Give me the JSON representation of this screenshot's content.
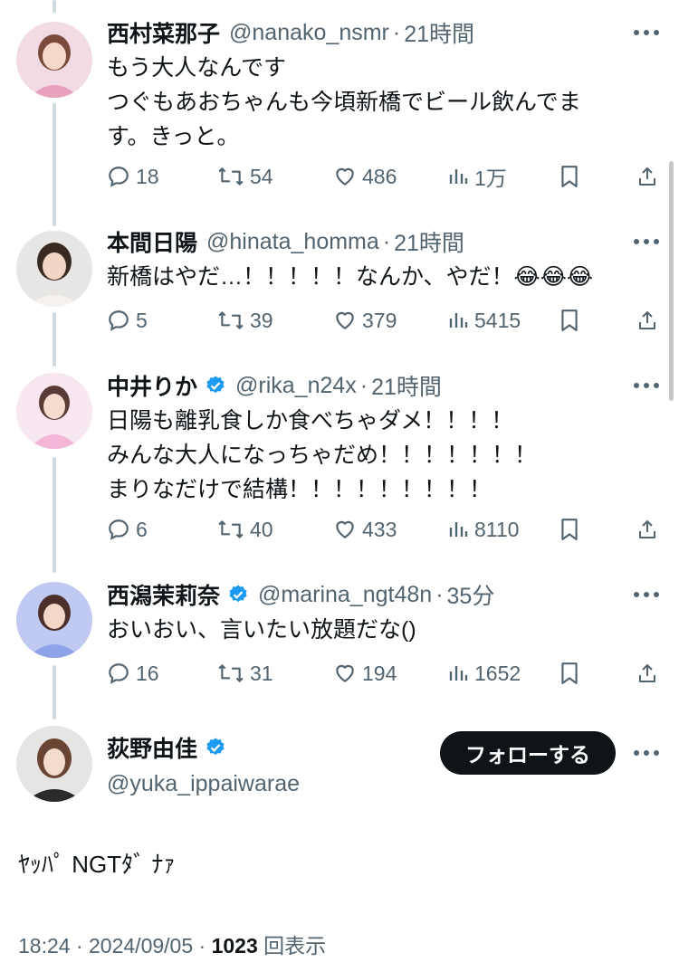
{
  "colors": {
    "text": "#0f1419",
    "secondary": "#536471",
    "verified": "#1d9bf0",
    "thread_line": "#cfd9de",
    "follow_bg": "#0f1419"
  },
  "replies": [
    {
      "name": "西村菜那子",
      "verified": false,
      "handle": "@nanako_nsmr",
      "time": "21時間",
      "text": "もう大人なんです\nつぐもあおちゃんも今頃新橋でビール飲んでま\nす。きっと。",
      "stats": {
        "replies": "18",
        "retweets": "54",
        "likes": "486",
        "views": "1万"
      }
    },
    {
      "name": "本間日陽",
      "verified": false,
      "handle": "@hinata_homma",
      "time": "21時間",
      "text": "新橋はやだ…！！！！！なんか、やだ！😂😂😂",
      "stats": {
        "replies": "5",
        "retweets": "39",
        "likes": "379",
        "views": "5415"
      }
    },
    {
      "name": "中井りか",
      "verified": true,
      "handle": "@rika_n24x",
      "time": "21時間",
      "text": "日陽も離乳食しか食べちゃダメ！！！！\nみんな大人になっちゃだめ！！！！！！！\nまりなだけで結構！！！！！！！！！",
      "stats": {
        "replies": "6",
        "retweets": "40",
        "likes": "433",
        "views": "8110"
      }
    },
    {
      "name": "西潟茉莉奈",
      "verified": true,
      "handle": "@marina_ngt48n",
      "time": "35分",
      "text": "おいおい、言いたい放題だな()",
      "stats": {
        "replies": "16",
        "retweets": "31",
        "likes": "194",
        "views": "1652"
      }
    }
  ],
  "main": {
    "name": "荻野由佳",
    "verified": true,
    "handle": "@yuka_ippaiwarae",
    "follow_label": "フォローする",
    "text": "ﾔｯﾊﾟ NGTﾀﾞ ﾅｧ",
    "time": "18:24",
    "date": "2024/09/05",
    "views_count": "1023",
    "views_label": "回表示"
  }
}
